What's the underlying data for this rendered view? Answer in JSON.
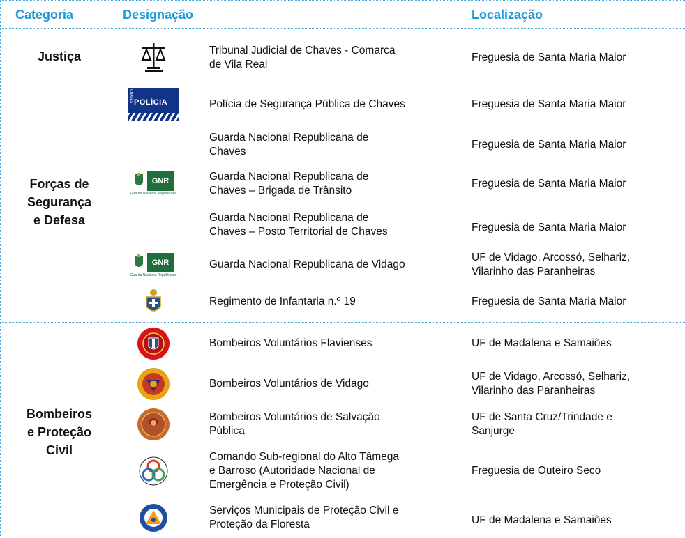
{
  "headers": {
    "categoria": "Categoria",
    "designacao": "Designação",
    "localizacao": "Localização"
  },
  "categories": {
    "justica": "Justiça",
    "forcas": [
      "Forças de",
      "Segurança",
      "e Defesa"
    ],
    "bombeiros": [
      "Bombeiros",
      "e Proteção",
      "Civil"
    ]
  },
  "rows": [
    {
      "designacao": [
        "Tribunal Judicial de Chaves - Comarca",
        "de Vila Real"
      ],
      "localizacao": [
        "Freguesia de Santa Maria Maior"
      ]
    },
    {
      "designacao": [
        "Polícia de Segurança Pública de Chaves"
      ],
      "localizacao": [
        "Freguesia de Santa Maria Maior"
      ]
    },
    {
      "designacao": [
        "Guarda Nacional Republicana de",
        "Chaves"
      ],
      "localizacao": [
        "Freguesia de Santa Maria Maior"
      ]
    },
    {
      "designacao": [
        "Guarda Nacional Republicana de",
        "Chaves – Brigada de Trânsito"
      ],
      "localizacao": [
        "Freguesia de Santa Maria Maior"
      ]
    },
    {
      "designacao": [
        "Guarda Nacional Republicana de",
        "Chaves – Posto Territorial de Chaves"
      ],
      "localizacao": [
        "Freguesia de Santa Maria Maior"
      ]
    },
    {
      "designacao": [
        "Guarda Nacional Republicana de Vidago"
      ],
      "localizacao": [
        "UF de Vidago, Arcossó, Selhariz,",
        "Vilarinho das Paranheiras"
      ]
    },
    {
      "designacao": [
        "Regimento de Infantaria n.º 19"
      ],
      "localizacao": [
        "Freguesia de Santa Maria Maior"
      ]
    },
    {
      "designacao": [
        "Bombeiros Voluntários Flavienses"
      ],
      "localizacao": [
        "UF de Madalena e Samaiões"
      ]
    },
    {
      "designacao": [
        "Bombeiros Voluntários de Vidago"
      ],
      "localizacao": [
        "UF de Vidago, Arcossó, Selhariz,",
        "Vilarinho das Paranheiras"
      ]
    },
    {
      "designacao": [
        "Bombeiros Voluntários de Salvação",
        "Pública"
      ],
      "localizacao": [
        "UF de Santa Cruz/Trindade e",
        "Sanjurge"
      ]
    },
    {
      "designacao": [
        "Comando Sub-regional do Alto Tâmega",
        "e Barroso (Autoridade Nacional de",
        "Emergência e Proteção Civil)"
      ],
      "localizacao": [
        "Freguesia de Outeiro Seco"
      ]
    },
    {
      "designacao": [
        "Serviços Municipais de Proteção Civil e",
        "Proteção da Floresta"
      ],
      "localizacao": [
        "UF de Madalena e Samaiões"
      ]
    }
  ],
  "logos": {
    "policia_text": "POLÍCIA",
    "policia_side": "CHAVES",
    "gnr_text": "GNR",
    "gnr_sub": "Guarda Nacional Republicana"
  },
  "colors": {
    "header": "#1a9ad6",
    "divider": "#4aa8dc",
    "policia": "#11348a",
    "gnr": "#1f6e3c"
  }
}
